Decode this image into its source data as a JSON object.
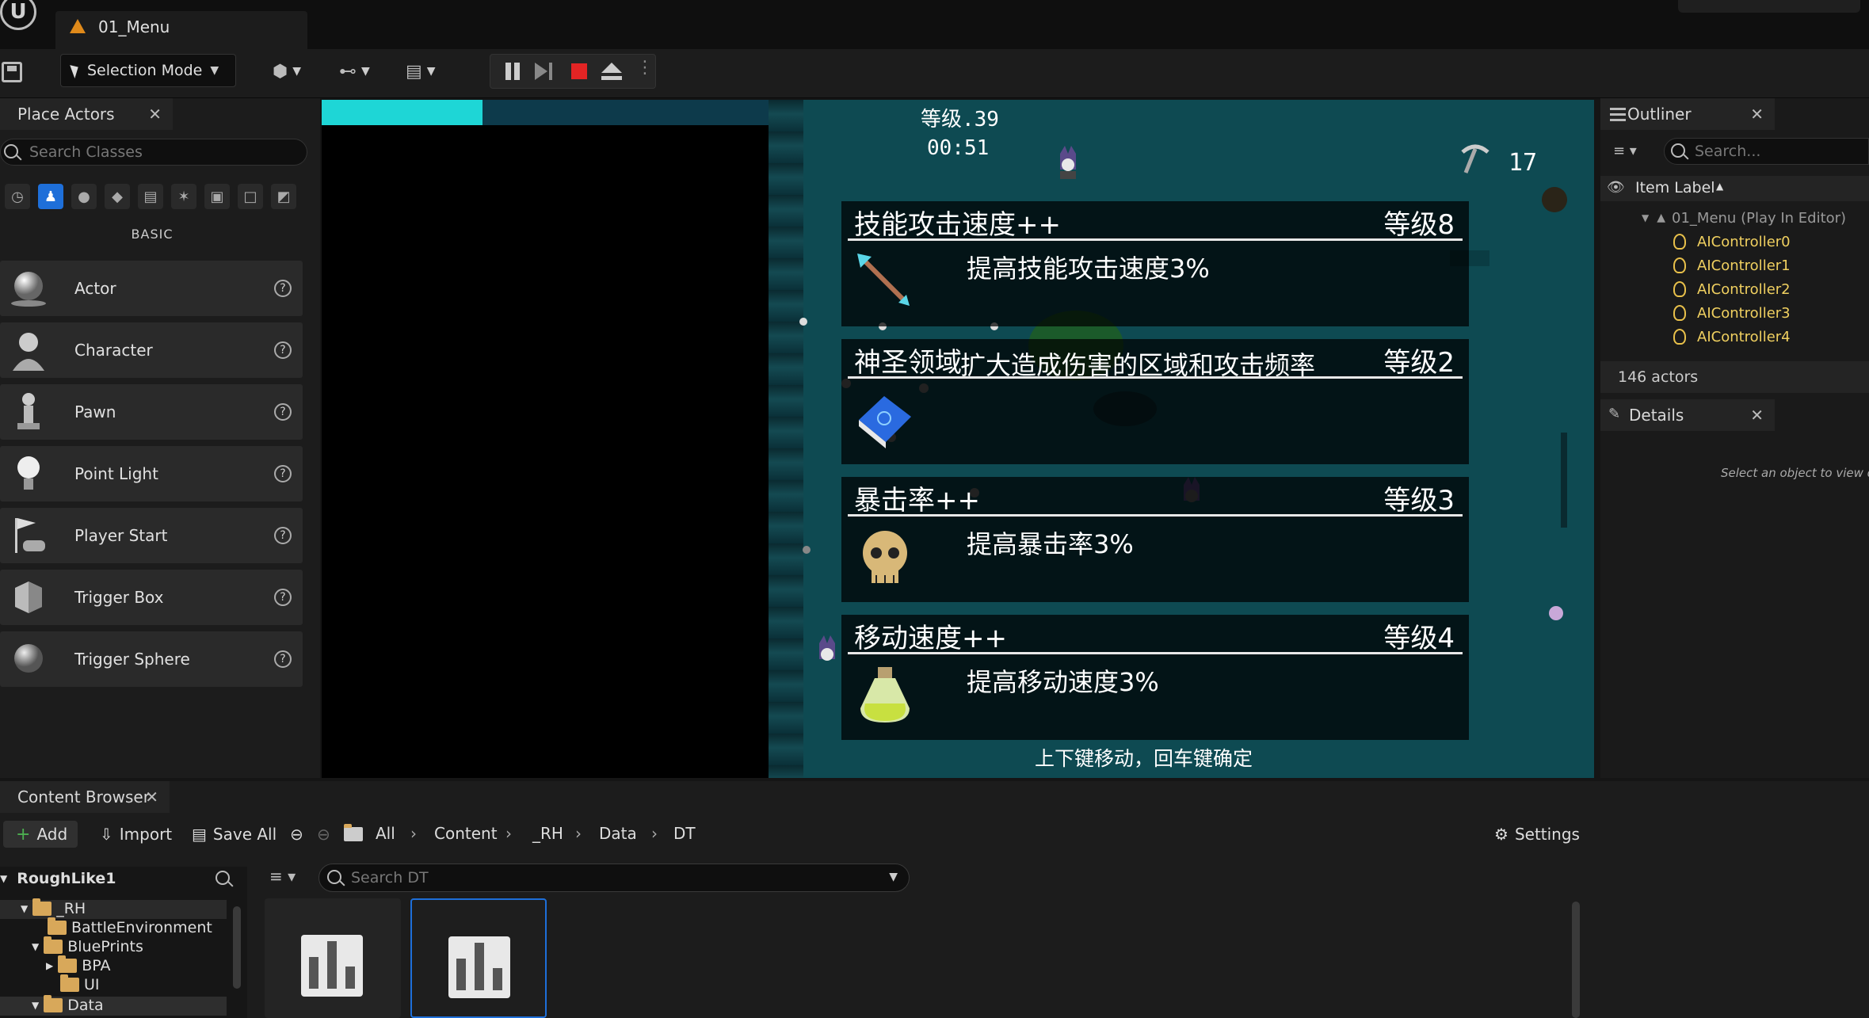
{
  "window": {
    "level_tab": "01_Menu"
  },
  "toolbar": {
    "selection_mode": "Selection Mode"
  },
  "place_actors": {
    "tab_title": "Place Actors",
    "search_placeholder": "Search Classes",
    "section": "BASIC",
    "items": [
      {
        "label": "Actor"
      },
      {
        "label": "Character"
      },
      {
        "label": "Pawn"
      },
      {
        "label": "Point Light"
      },
      {
        "label": "Player Start"
      },
      {
        "label": "Trigger Box"
      },
      {
        "label": "Trigger Sphere"
      }
    ]
  },
  "game": {
    "level": "等级.39",
    "timer": "00:51",
    "kills": "17",
    "xp_progress": 0.36,
    "cards": [
      {
        "title": "技能攻击速度++",
        "level": "等级8",
        "desc": "提高技能攻击速度3%"
      },
      {
        "title": "神圣领域",
        "level": "等级2",
        "desc": "扩大造成伤害的区域和攻击频率"
      },
      {
        "title": "暴击率++",
        "level": "等级3",
        "desc": "提高暴击率3%"
      },
      {
        "title": "移动速度++",
        "level": "等级4",
        "desc": "提高移动速度3%"
      }
    ],
    "hint": "上下键移动，回车键确定"
  },
  "outliner": {
    "tab_title": "Outliner",
    "search_placeholder": "Search...",
    "column": "Item Label",
    "root": "01_Menu (Play In Editor)",
    "items": [
      "AIController0",
      "AIController1",
      "AIController2",
      "AIController3",
      "AIController4"
    ],
    "actor_count": "146 actors"
  },
  "details": {
    "tab_title": "Details",
    "hint": "Select an object to view de"
  },
  "content_browser": {
    "tab_title": "Content Browser",
    "add": "Add",
    "import": "Import",
    "save_all": "Save All",
    "settings": "Settings",
    "breadcrumb": [
      "All",
      "Content",
      "_RH",
      "Data",
      "DT"
    ],
    "search_placeholder": "Search DT",
    "tree_root": "RoughLike1",
    "tree": [
      "_RH",
      "BattleEnvironment",
      "BluePrints",
      "BPA",
      "UI",
      "Data"
    ]
  },
  "colors": {
    "accent": "#1e6fd9",
    "xp_bar": "#1ed6d6",
    "stop": "#e32424",
    "controller_icon": "#e8c04a",
    "controller_text": "#f0d060"
  }
}
